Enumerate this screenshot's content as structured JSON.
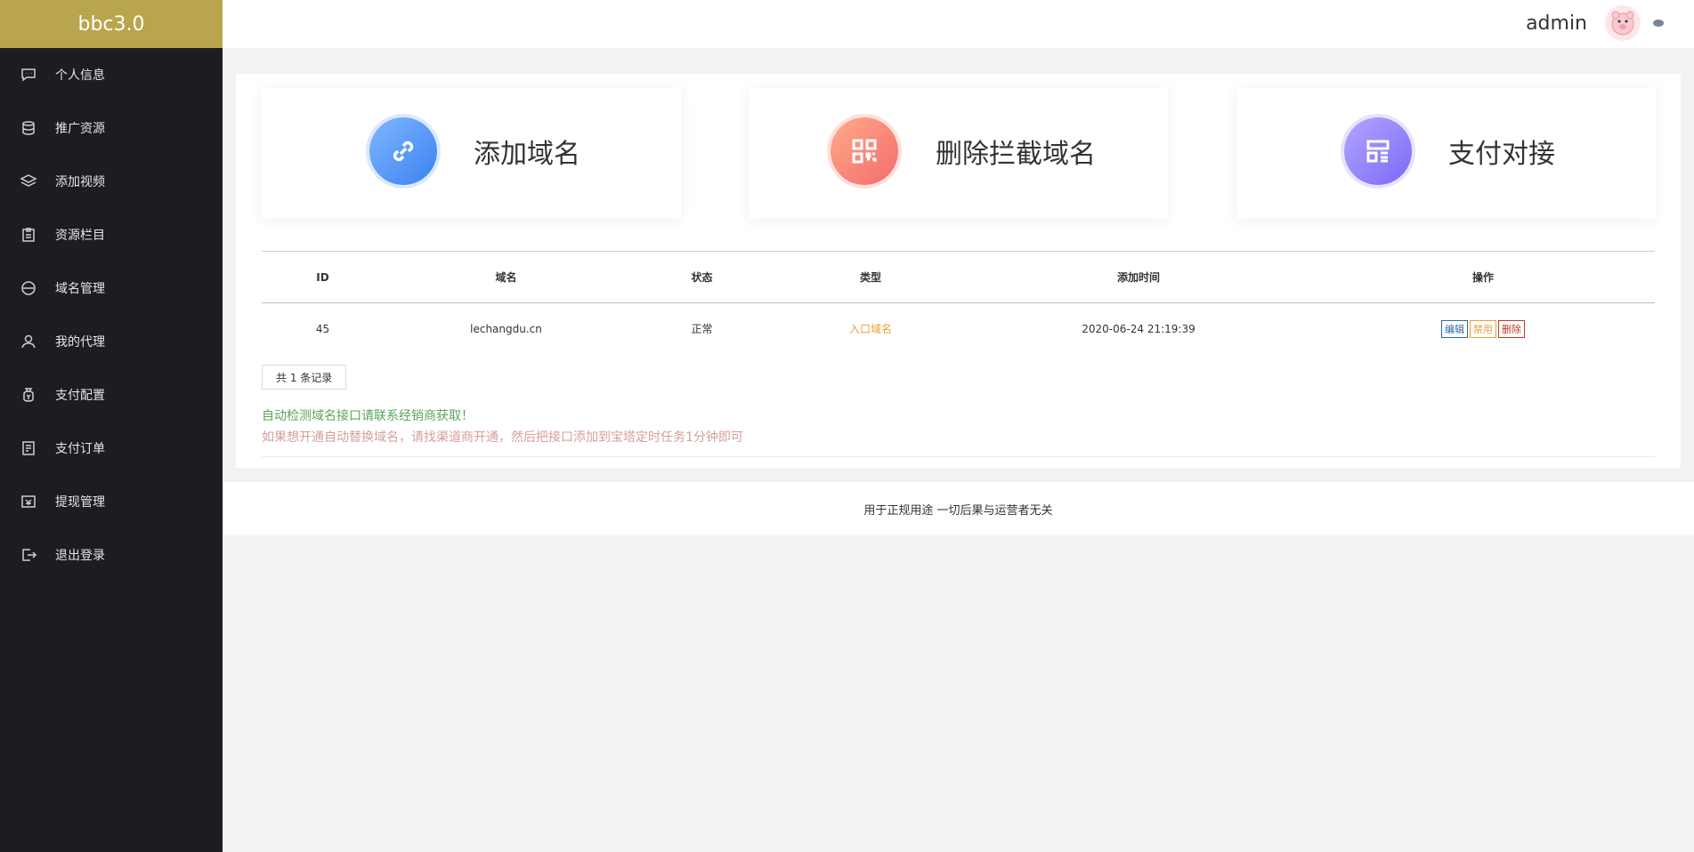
{
  "brand": "bbc3.0",
  "header": {
    "username": "admin"
  },
  "sidebar": {
    "items": [
      {
        "label": "个人信息",
        "icon": "message-icon"
      },
      {
        "label": "推广资源",
        "icon": "coins-icon"
      },
      {
        "label": "添加视频",
        "icon": "layers-icon"
      },
      {
        "label": "资源栏目",
        "icon": "clipboard-icon"
      },
      {
        "label": "域名管理",
        "icon": "www-icon"
      },
      {
        "label": "我的代理",
        "icon": "user-icon"
      },
      {
        "label": "支付配置",
        "icon": "money-bag-icon"
      },
      {
        "label": "支付订单",
        "icon": "order-icon"
      },
      {
        "label": "提现管理",
        "icon": "withdraw-icon"
      },
      {
        "label": "退出登录",
        "icon": "logout-icon"
      }
    ]
  },
  "cards": [
    {
      "label": "添加域名",
      "icon": "link-icon"
    },
    {
      "label": "删除拦截域名",
      "icon": "qrcode-icon"
    },
    {
      "label": "支付对接",
      "icon": "layout-icon"
    }
  ],
  "table": {
    "headers": [
      "ID",
      "域名",
      "状态",
      "类型",
      "添加时间",
      "操作"
    ],
    "rows": [
      {
        "id": "45",
        "domain": "lechangdu.cn",
        "status": "正常",
        "type": "入口域名",
        "time": "2020-06-24 21:19:39",
        "ops": [
          "编辑",
          "禁用",
          "删除"
        ]
      }
    ]
  },
  "records": "共 1 条记录",
  "notes": {
    "line1": "自动检测域名接口请联系经销商获取！",
    "line2": "如果想开通自动替换域名，请找渠道商开通，然后把接口添加到宝塔定时任务1分钟即可"
  },
  "footer": "用于正规用途 一切后果与运营者无关",
  "colors": {
    "brand_bg": "#b8a54e",
    "sidebar_bg": "#1d1c21",
    "note_green": "#5aa55a",
    "note_pink": "#d69d9d",
    "type_orange": "#e6a23c"
  }
}
